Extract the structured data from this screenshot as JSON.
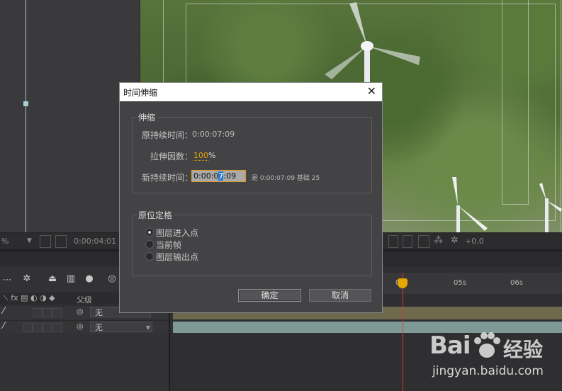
{
  "viewer_toolbar": {
    "zoom_value": "%",
    "timecode": "0:00:04:01",
    "exposure_value": "+0.0"
  },
  "timeline": {
    "parent_header": "父级",
    "layers": [
      {
        "parent": "无"
      },
      {
        "parent": "无"
      }
    ],
    "ruler_ticks": [
      "0s",
      "05s",
      "06s"
    ]
  },
  "dialog": {
    "title": "时间伸缩",
    "close_glyph": "✕",
    "stretch_group": {
      "legend": "伸缩",
      "original_duration_label": "原持续时间：",
      "original_duration_value": "0:00:07:09",
      "stretch_factor_label": "拉伸因数：",
      "stretch_factor_value": "100",
      "stretch_factor_unit": "%",
      "new_duration_label": "新持续时间：",
      "new_duration_before": "0:00:0",
      "new_duration_selected": "7",
      "new_duration_after": ":09",
      "equals_text": "是 0:00:07:09  基础 25"
    },
    "hold_group": {
      "legend": "原位定格",
      "options": [
        {
          "label": "图层进入点",
          "selected": true
        },
        {
          "label": "当前帧",
          "selected": false
        },
        {
          "label": "图层输出点",
          "selected": false
        }
      ]
    },
    "ok_label": "确定",
    "cancel_label": "取消"
  },
  "watermark": {
    "logo_text": "Bai",
    "brand_text": "经验",
    "url": "jingyan.baidu.com"
  },
  "colors": {
    "accent_orange": "#e6a300",
    "cti_red": "#d8392b",
    "dialog_bg": "#434345"
  }
}
